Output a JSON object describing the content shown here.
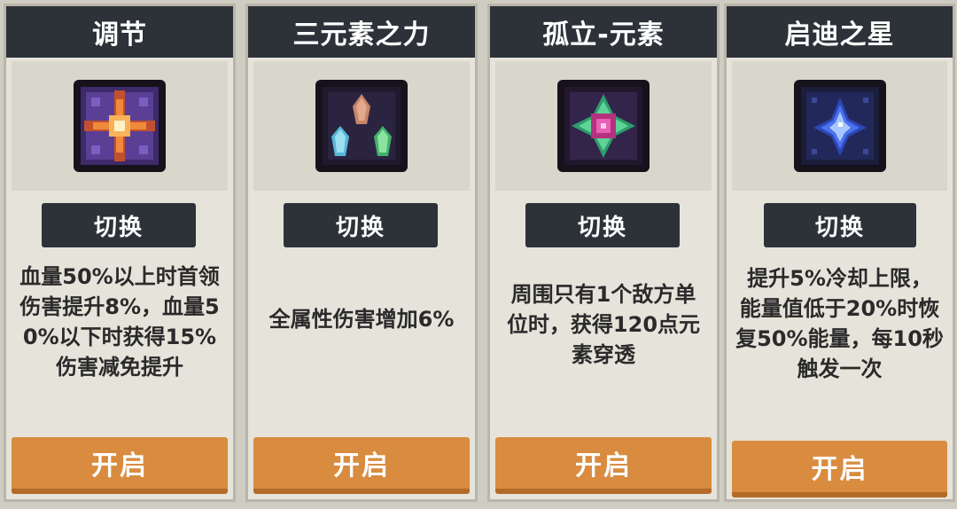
{
  "colors": {
    "header_bg": "#2c3238",
    "card_bg": "#e6e3da",
    "button_orange": "#d98c3f",
    "text_dark": "#2a2a2a"
  },
  "cards": [
    {
      "title": "调节",
      "icon": "cross-star-icon",
      "switch_label": "切换",
      "description": [
        "血量50%以上时首领",
        "伤害提升8%，血量5",
        "0%以下时获得15%",
        "伤害减免提升"
      ],
      "open_label": "开启"
    },
    {
      "title": "三元素之力",
      "icon": "three-crystals-icon",
      "switch_label": "切换",
      "description": [
        "全属性伤害增加6%"
      ],
      "open_label": "开启"
    },
    {
      "title": "孤立-元素",
      "icon": "element-gem-icon",
      "switch_label": "切换",
      "description": [
        "周围只有1个敌方单",
        "位时，获得120点元",
        "素穿透"
      ],
      "open_label": "开启"
    },
    {
      "title": "启迪之星",
      "icon": "blue-star-icon",
      "switch_label": "切换",
      "description": [
        "提升5%冷却上限，",
        "能量值低于20%时恢",
        "复50%能量，每10秒",
        "触发一次"
      ],
      "open_label": "开启"
    }
  ]
}
